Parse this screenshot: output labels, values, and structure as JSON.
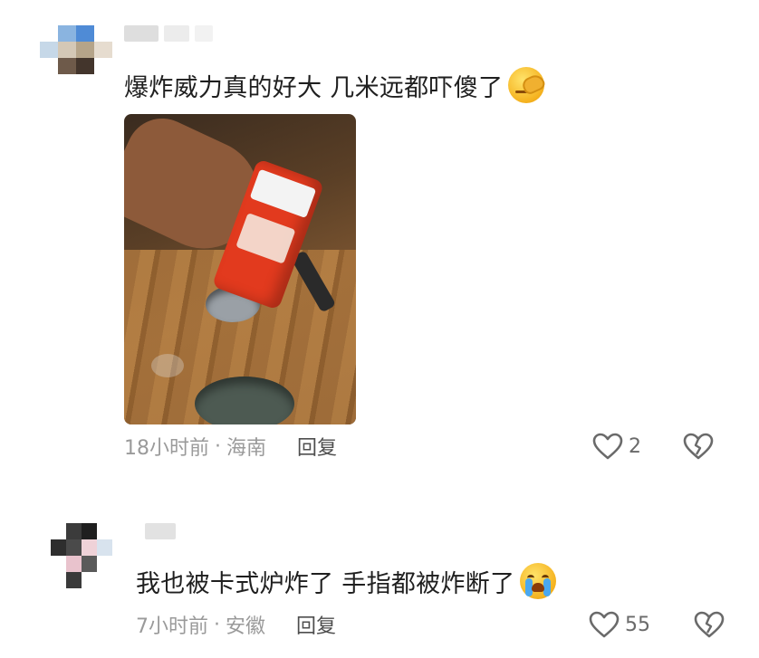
{
  "comments": [
    {
      "text": "爆炸威力真的好大 几米远都吓傻了",
      "emoji": "facepalm-emoji",
      "time": "18小时前",
      "location": "海南",
      "reply_label": "回复",
      "likes": "2",
      "avatar_colors": [
        "#ffffff",
        "#8ab4e0",
        "#4f8bd6",
        "#ffffff",
        "#c6d8e8",
        "#d4c8b6",
        "#b5a489",
        "#e6dccf",
        "#ffffff",
        "#6e5a4a",
        "#43352c",
        "#ffffff",
        "#ffffff",
        "#ffffff",
        "#ffffff",
        "#ffffff"
      ]
    },
    {
      "text": "我也被卡式炉炸了 手指都被炸断了",
      "emoji": "crying-emoji",
      "time": "7小时前",
      "location": "安徽",
      "reply_label": "回复",
      "likes": "55",
      "avatar_colors": [
        "#ffffff",
        "#3b3b3b",
        "#1f1f1f",
        "#ffffff",
        "#2e2e2e",
        "#4a4a4a",
        "#efd2d8",
        "#d8e3ee",
        "#ffffff",
        "#e9c3cd",
        "#5a5a5a",
        "#ffffff",
        "#ffffff",
        "#3a3a3a",
        "#ffffff",
        "#ffffff"
      ]
    }
  ],
  "separator": "·"
}
